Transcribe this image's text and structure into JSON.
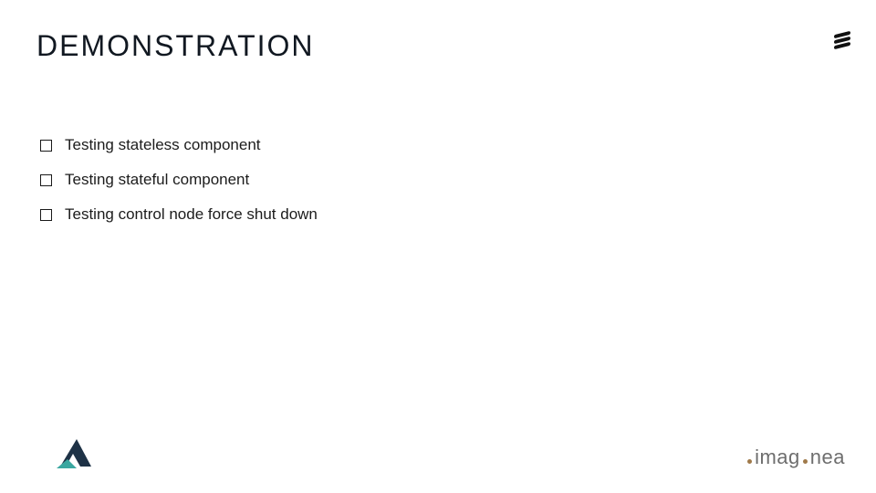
{
  "title": "DEMONSTRATION",
  "bullets": [
    "Testing stateless component",
    "Testing stateful component",
    "Testing control node force shut down"
  ],
  "logos": {
    "top_right": "ericsson-stripes-icon",
    "bottom_left": "mountain-logo-icon",
    "bottom_right_text": "imaginea"
  }
}
